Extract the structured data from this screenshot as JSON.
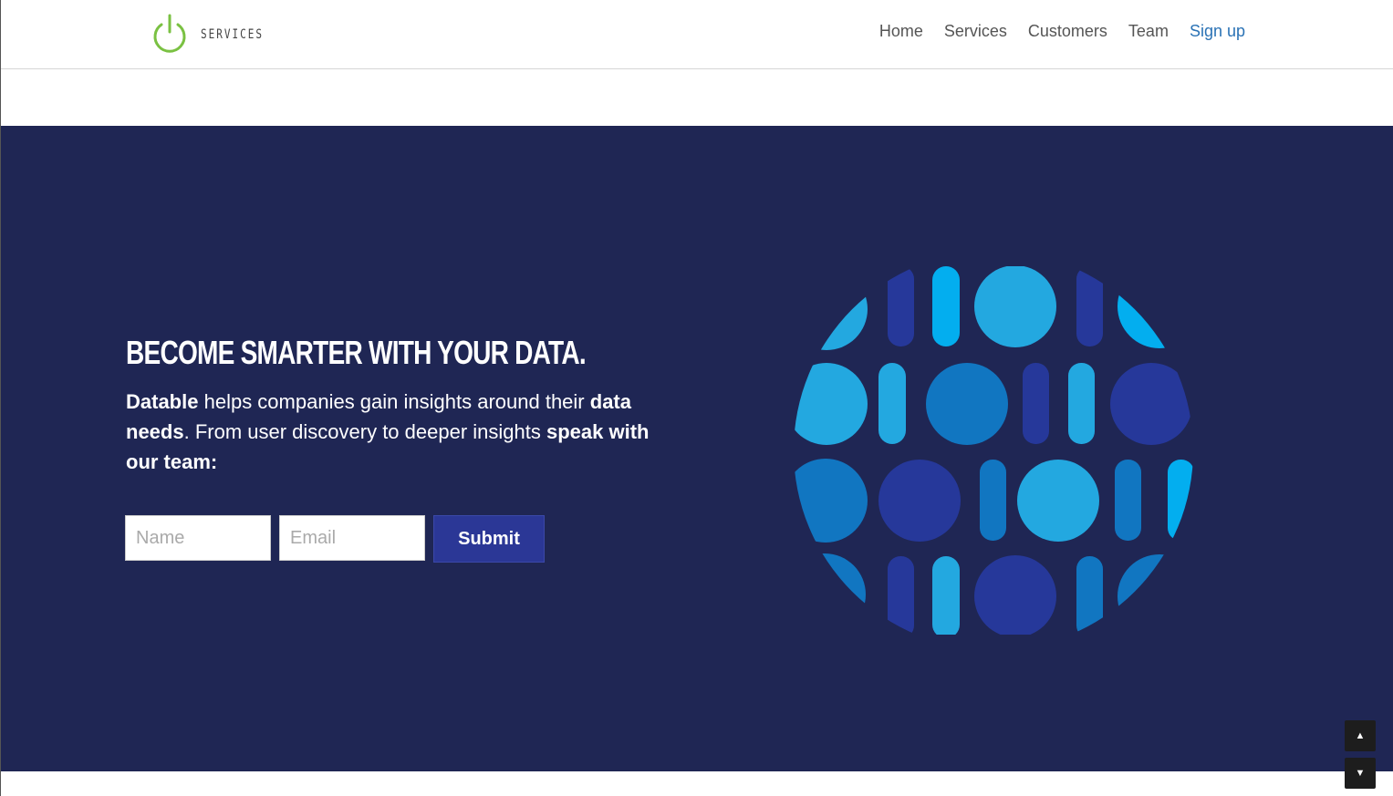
{
  "header": {
    "logo_text": "SERVICES",
    "logo_icon": "power-icon",
    "nav": [
      {
        "label": "Home"
      },
      {
        "label": "Services"
      },
      {
        "label": "Customers"
      },
      {
        "label": "Team"
      },
      {
        "label": "Sign up"
      }
    ]
  },
  "hero": {
    "headline": "BECOME SMARTER WITH YOUR DATA.",
    "lead": {
      "brand": "Datable",
      "part1": " helps companies gain insights around their ",
      "bold1": "data needs",
      "part2": ". From user discovery to deeper insights ",
      "bold2": "speak with our team:"
    },
    "form": {
      "name_placeholder": "Name",
      "email_placeholder": "Email",
      "submit_label": "Submit"
    }
  },
  "scroll": {
    "up_glyph": "▲",
    "down_glyph": "▼"
  },
  "colors": {
    "hero_bg": "#1f2654",
    "accent_green": "#7ac142",
    "link_blue": "#2a72b5",
    "button_blue": "#2b3796"
  }
}
